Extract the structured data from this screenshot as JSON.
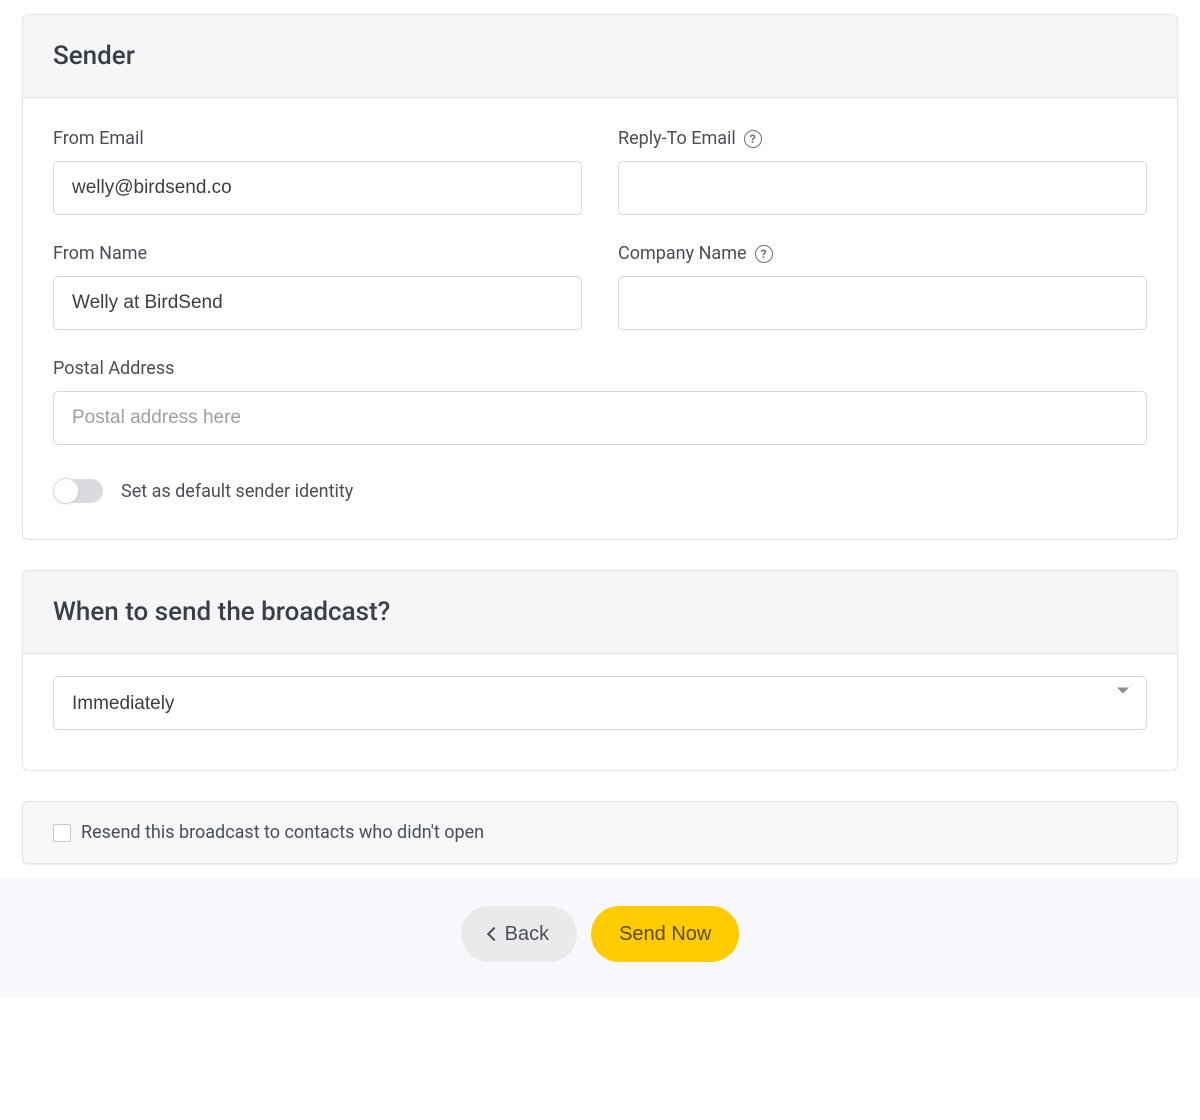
{
  "sender": {
    "title": "Sender",
    "from_email": {
      "label": "From Email",
      "value": "welly@birdsend.co"
    },
    "reply_to_email": {
      "label": "Reply-To Email",
      "value": ""
    },
    "from_name": {
      "label": "From Name",
      "value": "Welly at BirdSend"
    },
    "company_name": {
      "label": "Company Name",
      "value": ""
    },
    "postal_address": {
      "label": "Postal Address",
      "placeholder": "Postal address here",
      "value": ""
    },
    "default_toggle": {
      "label": "Set as default sender identity",
      "on": false
    }
  },
  "schedule": {
    "title": "When to send the broadcast?",
    "selected": "Immediately"
  },
  "resend": {
    "label": "Resend this broadcast to contacts who didn't open",
    "checked": false
  },
  "footer": {
    "back": "Back",
    "send_now": "Send Now"
  }
}
